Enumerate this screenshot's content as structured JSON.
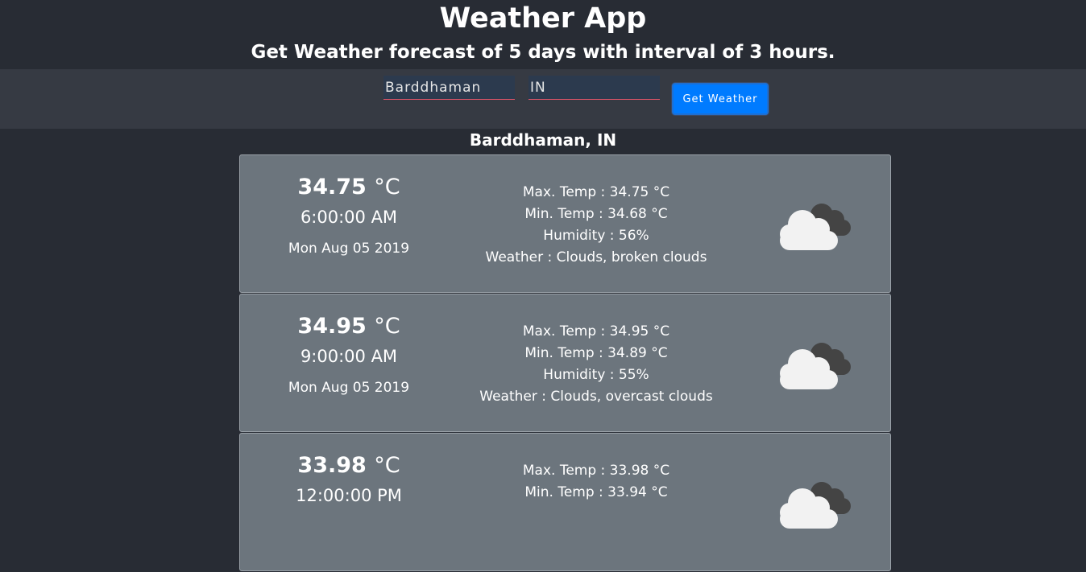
{
  "header": {
    "title": "Weather App",
    "subtitle": "Get Weather forecast of 5 days with interval of 3 hours."
  },
  "search": {
    "city_value": "Barddhaman",
    "country_value": "IN",
    "button_label": "Get Weather"
  },
  "location": "Barddhaman, IN",
  "forecasts": [
    {
      "temp": "34.75",
      "unit": "°C",
      "time": "6:00:00 AM",
      "date": "Mon Aug 05 2019",
      "max_temp": "Max. Temp : 34.75 °C",
      "min_temp": "Min. Temp : 34.68 °C",
      "humidity": "Humidity : 56%",
      "weather": "Weather : Clouds, broken clouds",
      "icon": "broken-clouds-icon"
    },
    {
      "temp": "34.95",
      "unit": "°C",
      "time": "9:00:00 AM",
      "date": "Mon Aug 05 2019",
      "max_temp": "Max. Temp : 34.95 °C",
      "min_temp": "Min. Temp : 34.89 °C",
      "humidity": "Humidity : 55%",
      "weather": "Weather : Clouds, overcast clouds",
      "icon": "overcast-clouds-icon"
    },
    {
      "temp": "33.98",
      "unit": "°C",
      "time": "12:00:00 PM",
      "date": "",
      "max_temp": "Max. Temp : 33.98 °C",
      "min_temp": "Min. Temp : 33.94 °C",
      "humidity": "",
      "weather": "",
      "icon": "clouds-icon"
    }
  ],
  "colors": {
    "background": "#282c34",
    "search_bar": "#363a43",
    "card": "#6c757d",
    "button": "#007bff",
    "field_underline": "#e0556a"
  }
}
